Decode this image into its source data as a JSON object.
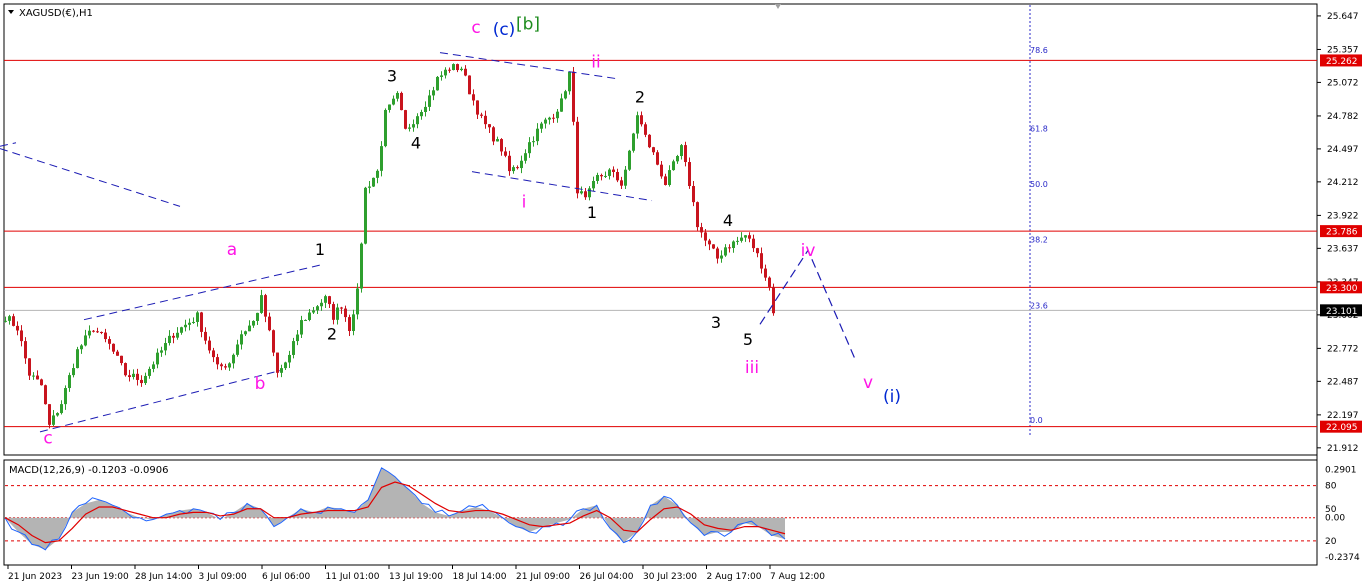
{
  "main_chart": {
    "title": "XAGUSD(€),H1",
    "colors": {
      "background": "#ffffff",
      "bull_candle": "#2e9f2e",
      "bear_candle": "#c8141e",
      "level_line": "#e00000",
      "channel": "#1c1cb4",
      "price_line": "#b4b4b4",
      "fib_vline": "#2828c8",
      "magenta": "#ff14e6",
      "blue": "#0028d2",
      "green": "#1e8c1e",
      "black": "#000000",
      "level_badge_text": "#ffffff",
      "current_badge": "#000000"
    }
  },
  "chart_data": [
    {
      "type": "candlestick",
      "symbol": "XAGUSD(€)",
      "timeframe": "H1",
      "ylim": [
        21.85,
        25.75
      ],
      "y_ticks": [
        "25.647",
        "25.357",
        "25.072",
        "24.782",
        "24.497",
        "24.212",
        "23.922",
        "23.637",
        "23.347",
        "23.062",
        "22.772",
        "22.487",
        "22.197",
        "21.912"
      ],
      "x_ticks": [
        "21 Jun 2023",
        "23 Jun 19:00",
        "28 Jun 14:00",
        "3 Jul 09:00",
        "6 Jul 06:00",
        "11 Jul 01:00",
        "13 Jul 19:00",
        "18 Jul 14:00",
        "21 Jul 09:00",
        "26 Jul 04:00",
        "30 Jul 23:00",
        "2 Aug 17:00",
        "7 Aug 12:00"
      ],
      "price_path": [
        [
          0,
          23.05
        ],
        [
          3,
          22.95
        ],
        [
          6,
          22.55
        ],
        [
          9,
          22.45
        ],
        [
          11,
          22.1
        ],
        [
          14,
          22.3
        ],
        [
          18,
          22.75
        ],
        [
          22,
          22.95
        ],
        [
          26,
          22.8
        ],
        [
          30,
          22.55
        ],
        [
          34,
          22.5
        ],
        [
          38,
          22.7
        ],
        [
          42,
          22.9
        ],
        [
          46,
          23.0
        ],
        [
          48,
          23.05
        ],
        [
          50,
          22.85
        ],
        [
          53,
          22.6
        ],
        [
          56,
          22.65
        ],
        [
          59,
          22.9
        ],
        [
          62,
          23.0
        ],
        [
          64,
          23.2
        ],
        [
          66,
          22.9
        ],
        [
          68,
          22.55
        ],
        [
          71,
          22.7
        ],
        [
          74,
          23.0
        ],
        [
          78,
          23.15
        ],
        [
          80,
          23.2
        ],
        [
          82,
          23.05
        ],
        [
          84,
          23.15
        ],
        [
          86,
          22.95
        ],
        [
          88,
          23.25
        ],
        [
          90,
          24.15
        ],
        [
          93,
          24.3
        ],
        [
          95,
          24.8
        ],
        [
          98,
          24.95
        ],
        [
          100,
          24.65
        ],
        [
          103,
          24.8
        ],
        [
          106,
          24.95
        ],
        [
          108,
          25.1
        ],
        [
          111,
          25.2
        ],
        [
          114,
          25.2
        ],
        [
          116,
          25.0
        ],
        [
          119,
          24.75
        ],
        [
          122,
          24.6
        ],
        [
          124,
          24.5
        ],
        [
          126,
          24.3
        ],
        [
          128,
          24.35
        ],
        [
          131,
          24.55
        ],
        [
          134,
          24.7
        ],
        [
          137,
          24.8
        ],
        [
          139,
          24.9
        ],
        [
          141,
          25.15
        ],
        [
          142,
          24.7
        ],
        [
          143,
          24.15
        ],
        [
          145,
          24.05
        ],
        [
          148,
          24.25
        ],
        [
          151,
          24.3
        ],
        [
          154,
          24.2
        ],
        [
          156,
          24.45
        ],
        [
          158,
          24.8
        ],
        [
          160,
          24.6
        ],
        [
          162,
          24.45
        ],
        [
          165,
          24.2
        ],
        [
          167,
          24.35
        ],
        [
          169,
          24.5
        ],
        [
          171,
          24.2
        ],
        [
          173,
          23.85
        ],
        [
          175,
          23.7
        ],
        [
          178,
          23.55
        ],
        [
          180,
          23.65
        ],
        [
          183,
          23.7
        ],
        [
          185,
          23.75
        ],
        [
          187,
          23.65
        ],
        [
          189,
          23.5
        ],
        [
          191,
          23.3
        ],
        [
          192,
          23.1
        ]
      ],
      "horizontal_levels": [
        "25.262",
        "23.786",
        "23.300",
        "22.095"
      ],
      "current_price": "23.101",
      "fibonacci": {
        "levels": [
          {
            "label": "78.6",
            "price": 25.3
          },
          {
            "label": "61.8",
            "price": 24.62
          },
          {
            "label": "50.0",
            "price": 24.14
          },
          {
            "label": "38.2",
            "price": 23.66
          },
          {
            "label": "23.6",
            "price": 23.09
          },
          {
            "label": "0.0",
            "price": 22.1
          }
        ]
      },
      "wave_labels": [
        {
          "text": "c",
          "bar": 11,
          "price": 21.95,
          "color": "magenta"
        },
        {
          "text": "a",
          "bar": 57,
          "price": 23.58,
          "color": "magenta"
        },
        {
          "text": "b",
          "bar": 64,
          "price": 22.42,
          "color": "magenta"
        },
        {
          "text": "1",
          "bar": 79,
          "price": 23.58,
          "color": "black"
        },
        {
          "text": "2",
          "bar": 82,
          "price": 22.85,
          "color": "black"
        },
        {
          "text": "3",
          "bar": 97,
          "price": 25.08,
          "color": "black"
        },
        {
          "text": "4",
          "bar": 103,
          "price": 24.5,
          "color": "black"
        },
        {
          "text": "c",
          "bar": 118,
          "price": 25.5,
          "color": "magenta"
        },
        {
          "text": "(c)",
          "bar": 125,
          "price": 25.48,
          "color": "blue"
        },
        {
          "text": "[b]",
          "bar": 131,
          "price": 25.53,
          "color": "green"
        },
        {
          "text": "ii",
          "bar": 148,
          "price": 25.2,
          "color": "magenta"
        },
        {
          "text": "i",
          "bar": 130,
          "price": 23.99,
          "color": "magenta"
        },
        {
          "text": "1",
          "bar": 147,
          "price": 23.9,
          "color": "black"
        },
        {
          "text": "2",
          "bar": 159,
          "price": 24.9,
          "color": "black"
        },
        {
          "text": "4",
          "bar": 181,
          "price": 23.83,
          "color": "black"
        },
        {
          "text": "3",
          "bar": 178,
          "price": 22.95,
          "color": "black"
        },
        {
          "text": "5",
          "bar": 186,
          "price": 22.8,
          "color": "black"
        },
        {
          "text": "iii",
          "bar": 187,
          "price": 22.56,
          "color": "magenta"
        },
        {
          "text": "iv",
          "bar": 201,
          "price": 23.57,
          "color": "magenta"
        },
        {
          "text": "v",
          "bar": 216,
          "price": 22.43,
          "color": "magenta"
        },
        {
          "text": "(i)",
          "bar": 222,
          "price": 22.31,
          "color": "blue"
        }
      ],
      "channel_lines": [
        {
          "x": [
            -1,
            44
          ],
          "price": [
            24.5,
            24.0
          ]
        },
        {
          "x": [
            -1,
            3
          ],
          "price": [
            24.52,
            24.55
          ]
        },
        {
          "x": [
            20,
            80
          ],
          "price": [
            23.02,
            23.5
          ]
        },
        {
          "x": [
            9,
            69
          ],
          "price": [
            22.05,
            22.58
          ]
        },
        {
          "x": [
            109,
            154
          ],
          "price": [
            25.33,
            25.1
          ]
        },
        {
          "x": [
            117,
            162
          ],
          "price": [
            24.3,
            24.05
          ]
        }
      ],
      "projection": [
        [
          189,
          22.98
        ],
        [
          201,
          23.62
        ],
        [
          213,
          22.66
        ]
      ]
    },
    {
      "type": "macd",
      "title": "MACD(12,26,9) -0.1203 -0.0906",
      "params": "12,26,9",
      "main_value": -0.1203,
      "signal_value": -0.0906,
      "ylim": [
        -0.2374,
        0.2901
      ],
      "y_ticks": [
        "0.2901",
        "80",
        "50",
        "0.00",
        "20",
        "-0.2374"
      ],
      "series": [
        {
          "name": "MACD",
          "values": [
            0.0,
            -0.08,
            -0.15,
            -0.18,
            -0.12,
            0.03,
            0.08,
            0.1,
            0.07,
            0.03,
            0.0,
            -0.01,
            0.02,
            0.04,
            0.05,
            0.03,
            -0.01,
            0.03,
            0.08,
            0.05,
            -0.05,
            0.0,
            0.05,
            0.03,
            0.06,
            0.05,
            0.03,
            0.1,
            0.28,
            0.23,
            0.16,
            0.08,
            0.03,
            0.01,
            0.04,
            0.06,
            0.04,
            0.0,
            -0.05,
            -0.08,
            -0.05,
            -0.03,
            -0.01,
            0.05,
            0.07,
            -0.06,
            -0.14,
            -0.08,
            0.07,
            0.12,
            0.07,
            -0.03,
            -0.1,
            -0.08,
            -0.08,
            -0.03,
            -0.05,
            -0.1,
            -0.12
          ]
        },
        {
          "name": "Signal",
          "values": [
            0.0,
            -0.04,
            -0.1,
            -0.14,
            -0.13,
            -0.06,
            0.02,
            0.06,
            0.06,
            0.04,
            0.02,
            0.0,
            0.0,
            0.02,
            0.03,
            0.03,
            0.01,
            0.02,
            0.05,
            0.05,
            0.0,
            0.0,
            0.02,
            0.03,
            0.04,
            0.04,
            0.04,
            0.06,
            0.17,
            0.2,
            0.18,
            0.13,
            0.08,
            0.04,
            0.03,
            0.04,
            0.04,
            0.02,
            -0.01,
            -0.04,
            -0.05,
            -0.04,
            -0.03,
            0.01,
            0.04,
            0.0,
            -0.07,
            -0.08,
            -0.01,
            0.05,
            0.06,
            0.02,
            -0.04,
            -0.06,
            -0.07,
            -0.05,
            -0.05,
            -0.07,
            -0.09
          ]
        }
      ],
      "colors": {
        "histogram": "#b4b4b4",
        "main": "#1e64ff",
        "signal": "#e00000",
        "level_line": "#e00000"
      }
    }
  ]
}
